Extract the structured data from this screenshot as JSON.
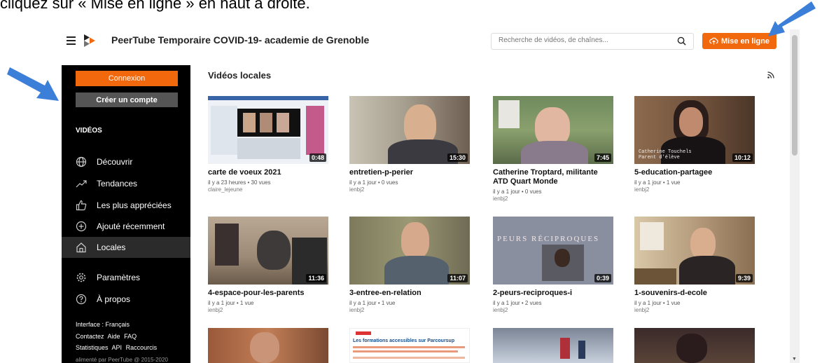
{
  "caption": "cliquez sur « Mise en ligne » en haut à droite.",
  "header": {
    "site_title": "PeerTube Temporaire COVID-19- academie de Grenoble",
    "search_placeholder": "Recherche de vidéos, de chaînes...",
    "upload_label": "Mise en ligne"
  },
  "sidebar": {
    "login_label": "Connexion",
    "signup_label": "Créer un compte",
    "section_title": "VIDÉOS",
    "items": [
      {
        "label": "Découvrir",
        "icon": "globe-icon"
      },
      {
        "label": "Tendances",
        "icon": "trending-icon"
      },
      {
        "label": "Les plus appréciées",
        "icon": "thumbs-up-icon"
      },
      {
        "label": "Ajouté récemment",
        "icon": "plus-circle-icon"
      },
      {
        "label": "Locales",
        "icon": "home-icon"
      },
      {
        "label": "Paramètres",
        "icon": "gear-icon"
      },
      {
        "label": "À propos",
        "icon": "help-icon"
      }
    ],
    "footer_line1": [
      "Interface : Français"
    ],
    "footer_line2": [
      "Contactez",
      "Aide",
      "FAQ"
    ],
    "footer_line3": [
      "Statistiques",
      "API",
      "Raccourcis"
    ],
    "powered_by": "alimenté par PeerTube @ 2015-2020"
  },
  "main": {
    "title": "Vidéos locales",
    "videos": [
      {
        "title": "carte de voeux 2021",
        "meta": "il y a 23 heures • 30 vues",
        "channel": "claire_lejeune",
        "duration": "0:48"
      },
      {
        "title": "entretien-p-perier",
        "meta": "il y a 1 jour • 0 vues",
        "channel": "ienbj2",
        "duration": "15:30"
      },
      {
        "title": "Catherine Troptard, militante ATD Quart Monde",
        "meta": "il y a 1 jour • 0 vues",
        "channel": "ienbj2",
        "duration": "7:45"
      },
      {
        "title": "5-education-partagee",
        "meta": "il y a 1 jour • 1 vue",
        "channel": "ienbj2",
        "duration": "10:12",
        "overlay": "Catherine Touchels\nParent d'élève"
      },
      {
        "title": "4-espace-pour-les-parents",
        "meta": "il y a 1 jour • 1 vue",
        "channel": "ienbj2",
        "duration": "11:36"
      },
      {
        "title": "3-entree-en-relation",
        "meta": "il y a 1 jour • 1 vue",
        "channel": "ienbj2",
        "duration": "11:07"
      },
      {
        "title": "2-peurs-reciproques-i",
        "meta": "il y a 1 jour • 2 vues",
        "channel": "ienbj2",
        "duration": "0:39",
        "overlay": "PEURS RÉCIPROQUES"
      },
      {
        "title": "1-souvenirs-d-ecole",
        "meta": "il y a 1 jour • 1 vue",
        "channel": "ienbj2",
        "duration": "9:39"
      }
    ],
    "partial_thumb_text": "Les formations accessibles sur Parcoursup"
  },
  "colors": {
    "accent": "#f1680d",
    "sidebar_bg": "#000000",
    "arrow": "#3c7fd8"
  }
}
